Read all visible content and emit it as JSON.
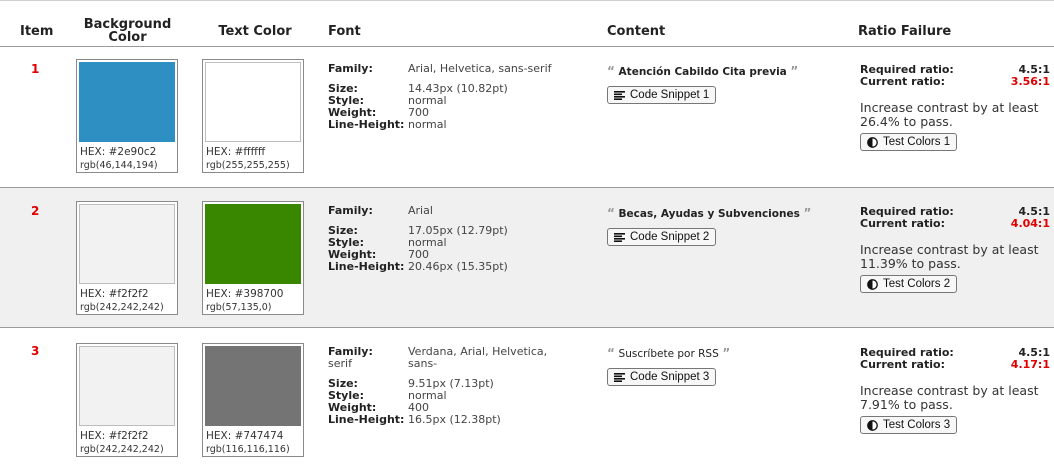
{
  "columns": {
    "item": "Item",
    "background": "Background Color",
    "text_color": "Text Color",
    "font": "Font",
    "content": "Content",
    "ratio": "Ratio Failure"
  },
  "labels": {
    "family": "Family:",
    "size": "Size:",
    "style": "Style:",
    "weight": "Weight:",
    "line_height": "Line-Height:",
    "required": "Required ratio:",
    "current": "Current ratio:",
    "hex_prefix": "HEX:"
  },
  "rows": [
    {
      "num": "1",
      "bg": {
        "color": "#2e90c2",
        "hex": "HEX: #2e90c2",
        "rgb": "rgb(46,144,194)"
      },
      "fg": {
        "color": "#ffffff",
        "hex": "HEX: #ffffff",
        "rgb": "rgb(255,255,255)"
      },
      "font": {
        "family": "Arial, Helvetica, sans-serif",
        "family_cont": "",
        "size": "14.43px (10.82pt)",
        "style": "normal",
        "weight": "700",
        "line_height": "normal"
      },
      "content": {
        "text": "Atención Cabildo Cita previa",
        "bold": true,
        "button": "Code Snippet 1"
      },
      "ratio": {
        "required": "4.5:1",
        "current": "3.56:1",
        "advice": "Increase contrast by at least 26.4% to pass.",
        "button": "Test Colors 1"
      }
    },
    {
      "num": "2",
      "bg": {
        "color": "#f2f2f2",
        "hex": "HEX: #f2f2f2",
        "rgb": "rgb(242,242,242)"
      },
      "fg": {
        "color": "#398700",
        "hex": "HEX: #398700",
        "rgb": "rgb(57,135,0)"
      },
      "font": {
        "family": "Arial",
        "family_cont": "",
        "size": "17.05px (12.79pt)",
        "style": "normal",
        "weight": "700",
        "line_height": "20.46px (15.35pt)"
      },
      "content": {
        "text": "Becas, Ayudas y Subvenciones",
        "bold": true,
        "button": "Code Snippet 2"
      },
      "ratio": {
        "required": "4.5:1",
        "current": "4.04:1",
        "advice": "Increase contrast by at least 11.39% to pass.",
        "button": "Test Colors 2"
      }
    },
    {
      "num": "3",
      "bg": {
        "color": "#f2f2f2",
        "hex": "HEX: #f2f2f2",
        "rgb": "rgb(242,242,242)"
      },
      "fg": {
        "color": "#747474",
        "hex": "HEX: #747474",
        "rgb": "rgb(116,116,116)"
      },
      "font": {
        "family": "Verdana, Arial, Helvetica, sans-",
        "family_cont": "serif",
        "size": "9.51px (7.13pt)",
        "style": "normal",
        "weight": "400",
        "line_height": "16.5px (12.38pt)"
      },
      "content": {
        "text": "Suscríbete por RSS",
        "bold": false,
        "button": "Code Snippet 3"
      },
      "ratio": {
        "required": "4.5:1",
        "current": "4.17:1",
        "advice": "Increase contrast by at least 7.91% to pass.",
        "button": "Test Colors 3"
      }
    }
  ],
  "icons": {
    "quote_open": "“",
    "quote_close": "”",
    "snippet_icon": "align-left-icon",
    "test_icon": "contrast-icon"
  }
}
